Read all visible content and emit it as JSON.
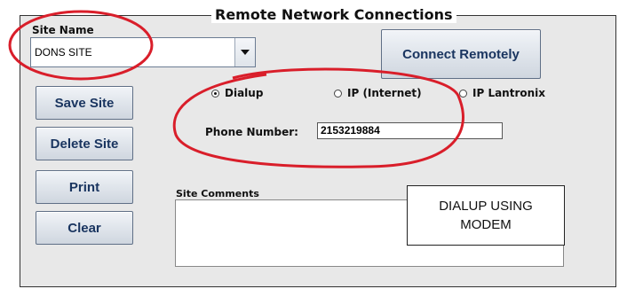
{
  "group": {
    "title": "Remote Network Connections"
  },
  "site": {
    "label": "Site Name",
    "value": "DONS SITE",
    "arrow_icon": "chevron-down-icon"
  },
  "buttons": {
    "connect": "Connect Remotely",
    "save": "Save Site",
    "delete": "Delete Site",
    "print": "Print",
    "clear": "Clear"
  },
  "connection_types": [
    {
      "label": "Dialup",
      "selected": true
    },
    {
      "label": "IP (Internet)",
      "selected": false
    },
    {
      "label": "IP Lantronix",
      "selected": false
    }
  ],
  "phone": {
    "label": "Phone Number:",
    "value": "2153219884"
  },
  "comments": {
    "label": "Site Comments",
    "value": ""
  },
  "callout": {
    "line1": "DIALUP USING",
    "line2": "MODEM"
  },
  "colors": {
    "annotation": "#d91e2a",
    "button_text": "#1a3560"
  }
}
